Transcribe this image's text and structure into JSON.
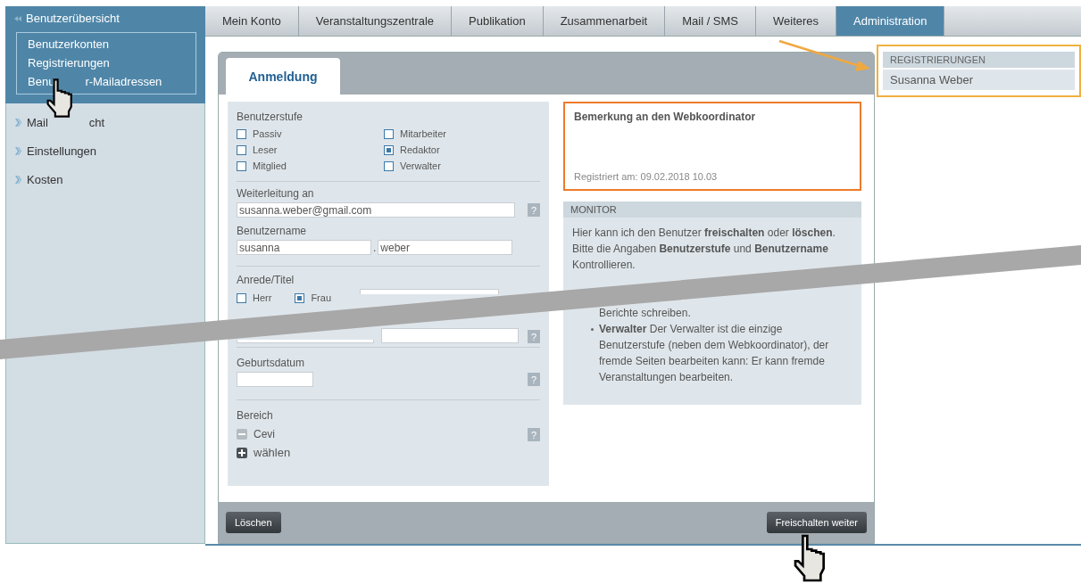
{
  "sidebar": {
    "header": "Benutzerübersicht",
    "submenu": [
      {
        "parts": [
          "Benutzerkonten"
        ]
      },
      {
        "parts": [
          "Registrierungen"
        ]
      },
      {
        "parts": [
          "Benu",
          "r-Mailadressen"
        ]
      }
    ],
    "items": [
      {
        "parts": [
          "Mail",
          "cht"
        ]
      },
      {
        "parts": [
          "Einstellungen"
        ]
      },
      {
        "parts": [
          "Kosten"
        ]
      }
    ]
  },
  "nav_tabs": [
    {
      "label": "Mein Konto",
      "selected": false
    },
    {
      "label": "Veranstaltungszentrale",
      "selected": false
    },
    {
      "label": "Publikation",
      "selected": false
    },
    {
      "label": "Zusammenarbeit",
      "selected": false
    },
    {
      "label": "Mail / SMS",
      "selected": false
    },
    {
      "label": "Weiteres",
      "selected": false
    },
    {
      "label": "Administration",
      "selected": true
    }
  ],
  "panel": {
    "tabs": [
      {
        "label": "Anmeldung",
        "selected": true
      }
    ],
    "form": {
      "benutzerstufe": {
        "label": "Benutzerstufe",
        "options": [
          {
            "label": "Passiv",
            "checked": false
          },
          {
            "label": "Leser",
            "checked": false
          },
          {
            "label": "Mitglied",
            "checked": false
          },
          {
            "label": "Mitarbeiter",
            "checked": false
          },
          {
            "label": "Redaktor",
            "checked": true
          },
          {
            "label": "Verwalter",
            "checked": false
          }
        ]
      },
      "weiterleitung": {
        "label": "Weiterleitung an",
        "value": "susanna.weber@gmail.com",
        "help": "?"
      },
      "benutzername": {
        "label": "Benutzername",
        "first": "susanna",
        "separator": ".",
        "last": "weber"
      },
      "anrede": {
        "label": "Anrede/Titel",
        "options": [
          {
            "label": "Herr",
            "checked": false
          },
          {
            "label": "Frau",
            "checked": true
          }
        ],
        "help": "?"
      },
      "geburtsdatum": {
        "label": "Geburtsdatum",
        "help": "?"
      },
      "bereich": {
        "label": "Bereich",
        "items": [
          {
            "kind": "remove",
            "label": "Cevi"
          },
          {
            "kind": "add",
            "label": "wählen"
          }
        ],
        "help": "?"
      }
    },
    "remark": {
      "title": "Bemerkung an den Webkoordinator",
      "registered": "Registriert am: 09.02.2018 10.03"
    },
    "monitor": {
      "heading": "MONITOR",
      "text": "Hier kann ich den Benutzer **freischalten** oder **löschen**. Bitte die Angaben **Benutzerstufe** und **Benutzername** Kontrollieren.",
      "list": [
        {
          "kind": "continuation",
          "text": "Berichte schreiben."
        },
        {
          "kind": "item",
          "text": "**Verwalter** Der Verwalter ist die einzige Benutzerstufe (neben dem Webkoordinator), der fremde Seiten bearbeiten kann: Er kann fremde Veranstaltungen bearbeiten."
        }
      ]
    },
    "buttons": {
      "delete": "Löschen",
      "confirm": "Freischalten weiter"
    }
  },
  "registrations": {
    "heading": "REGISTRIERUNGEN",
    "items": [
      "Susanna Weber"
    ]
  }
}
